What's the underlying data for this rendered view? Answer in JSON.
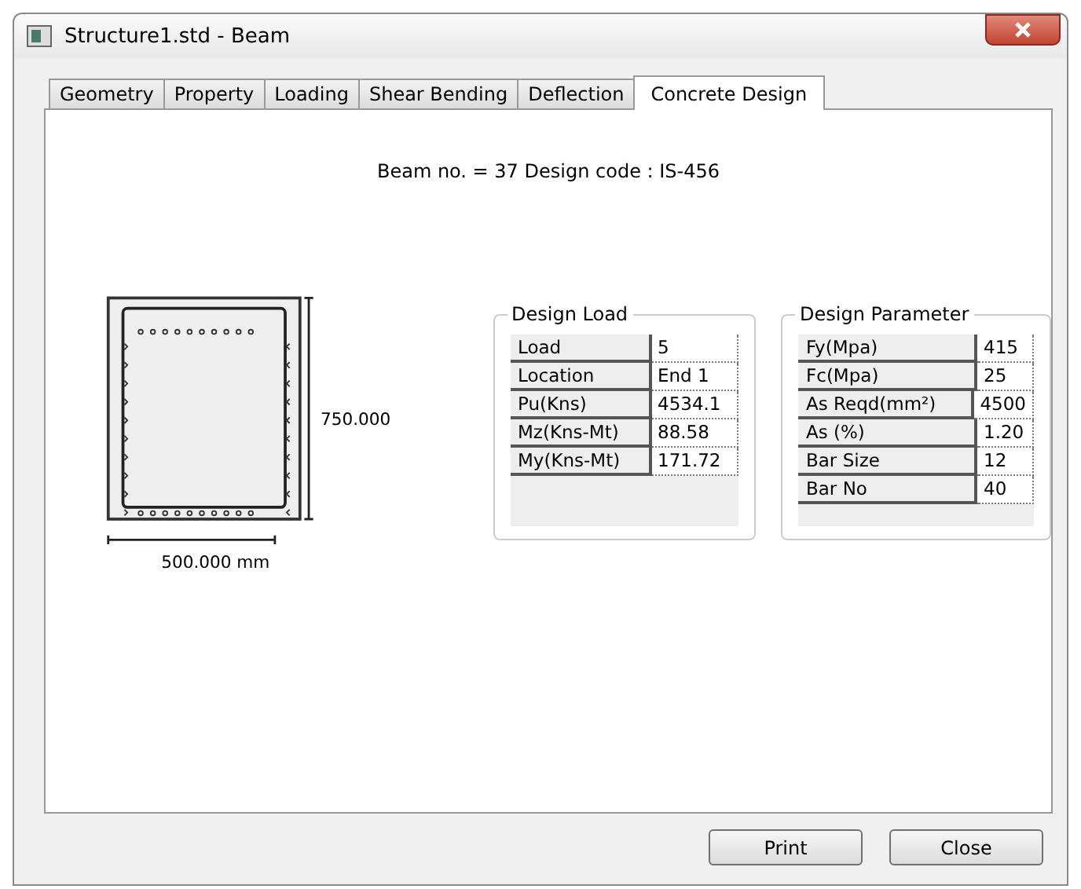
{
  "window": {
    "title": "Structure1.std - Beam"
  },
  "tabs": [
    {
      "label": "Geometry",
      "selected": false
    },
    {
      "label": "Property",
      "selected": false
    },
    {
      "label": "Loading",
      "selected": false
    },
    {
      "label": "Shear Bending",
      "selected": false
    },
    {
      "label": "Deflection",
      "selected": false
    },
    {
      "label": "Concrete Design",
      "selected": true
    }
  ],
  "heading": "Beam no. = 37  Design code :  IS-456",
  "section": {
    "depth_label": "750.000",
    "width_label": "500.000 mm"
  },
  "groups": [
    {
      "title": "Design Load",
      "rows": [
        {
          "label": "Load",
          "value": "5"
        },
        {
          "label": "Location",
          "value": "End 1"
        },
        {
          "label": "Pu(Kns)",
          "value": "4534.1"
        },
        {
          "label": "Mz(Kns-Mt)",
          "value": "88.58"
        },
        {
          "label": "My(Kns-Mt)",
          "value": "171.72"
        }
      ]
    },
    {
      "title": "Design Parameter",
      "rows": [
        {
          "label": "Fy(Mpa)",
          "value": "415"
        },
        {
          "label": "Fc(Mpa)",
          "value": "25"
        },
        {
          "label": "As Reqd(mm²)",
          "value": "4500"
        },
        {
          "label": "As (%)",
          "value": "1.20"
        },
        {
          "label": "Bar Size",
          "value": "12"
        },
        {
          "label": "Bar No",
          "value": "40"
        }
      ]
    }
  ],
  "buttons": [
    "Print",
    "Close"
  ]
}
